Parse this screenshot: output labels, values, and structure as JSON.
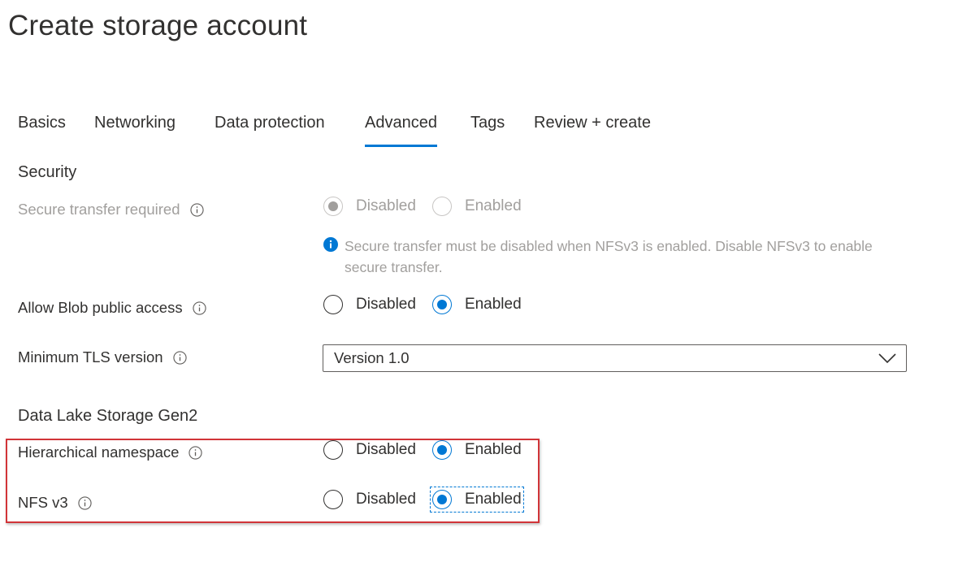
{
  "page": {
    "title": "Create storage account"
  },
  "tabs": [
    {
      "label": "Basics"
    },
    {
      "label": "Networking"
    },
    {
      "label": "Data protection"
    },
    {
      "label": "Advanced",
      "active": true
    },
    {
      "label": "Tags"
    },
    {
      "label": "Review + create"
    }
  ],
  "security": {
    "heading": "Security",
    "secure_transfer": {
      "label": "Secure transfer required",
      "options": [
        "Disabled",
        "Enabled"
      ],
      "selected": "Disabled",
      "disabled": true
    },
    "info_message": "Secure transfer must be disabled when NFSv3 is enabled. Disable NFSv3 to enable secure transfer.",
    "blob_public_access": {
      "label": "Allow Blob public access",
      "options": [
        "Disabled",
        "Enabled"
      ],
      "selected": "Enabled"
    },
    "min_tls": {
      "label": "Minimum TLS version",
      "value": "Version 1.0"
    }
  },
  "data_lake": {
    "heading": "Data Lake Storage Gen2",
    "hierarchical_namespace": {
      "label": "Hierarchical namespace",
      "options": [
        "Disabled",
        "Enabled"
      ],
      "selected": "Enabled"
    },
    "nfs_v3": {
      "label": "NFS v3",
      "options": [
        "Disabled",
        "Enabled"
      ],
      "selected": "Enabled"
    }
  },
  "colors": {
    "accent": "#0078d4",
    "highlight_border": "#d13438",
    "disabled_text": "#a19f9d",
    "text": "#323130"
  },
  "icons": {
    "info": "info-icon",
    "info_filled": "info-filled-icon",
    "dropdown": "chevron-down-icon"
  }
}
